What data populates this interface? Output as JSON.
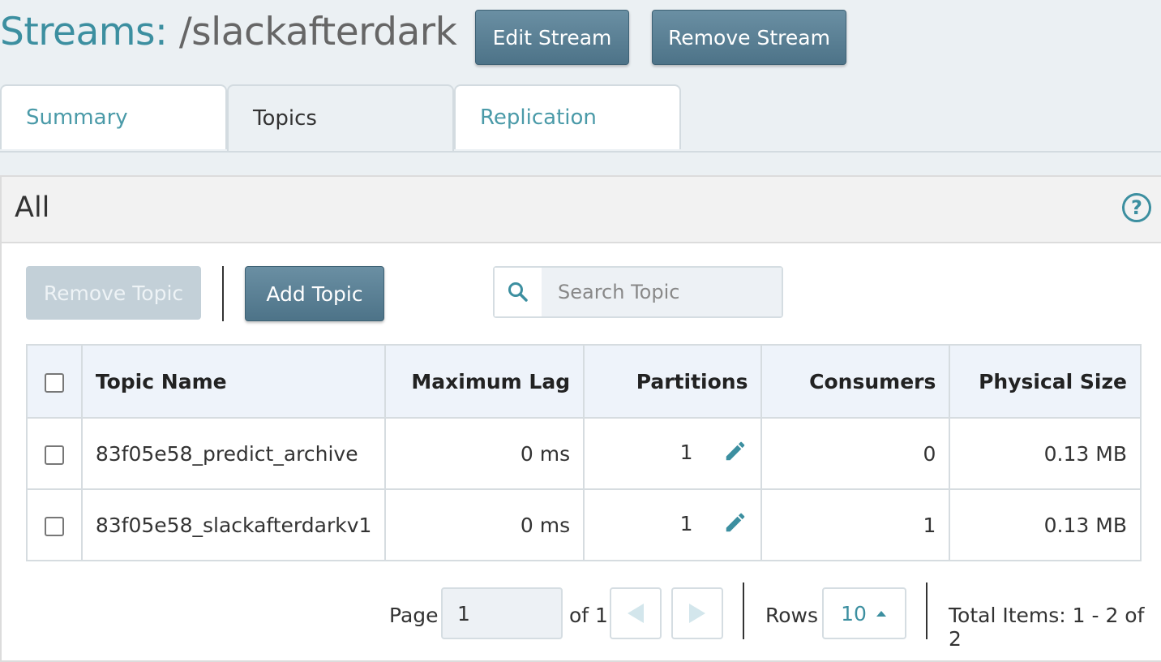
{
  "header": {
    "title_prefix": "Streams:",
    "title_name": "/slackafterdark",
    "edit_label": "Edit Stream",
    "remove_label": "Remove Stream"
  },
  "tabs": [
    {
      "label": "Summary",
      "active": false
    },
    {
      "label": "Topics",
      "active": true
    },
    {
      "label": "Replication",
      "active": false
    }
  ],
  "panel": {
    "title": "All",
    "help_icon": "help-circle-icon"
  },
  "toolbar": {
    "remove_topic_label": "Remove Topic",
    "add_topic_label": "Add Topic",
    "search_placeholder": "Search Topic",
    "search_value": ""
  },
  "table": {
    "columns": [
      "Topic Name",
      "Maximum Lag",
      "Partitions",
      "Consumers",
      "Physical Size"
    ],
    "rows": [
      {
        "name": "83f05e58_predict_archive",
        "lag": "0 ms",
        "partitions": "1",
        "consumers": "0",
        "size": "0.13 MB"
      },
      {
        "name": "83f05e58_slackafterdarkv1",
        "lag": "0 ms",
        "partitions": "1",
        "consumers": "1",
        "size": "0.13 MB"
      }
    ]
  },
  "pager": {
    "page_label": "Page",
    "page_value": "1",
    "of_label": "of 1",
    "rows_label": "Rows",
    "rows_value": "10",
    "total_label": "Total Items: 1 - 2 of 2"
  },
  "colors": {
    "accent": "#3c8fa0",
    "button_dark": "#557b90",
    "button_disabled": "#c3d0d8",
    "background": "#ebf0f3"
  }
}
